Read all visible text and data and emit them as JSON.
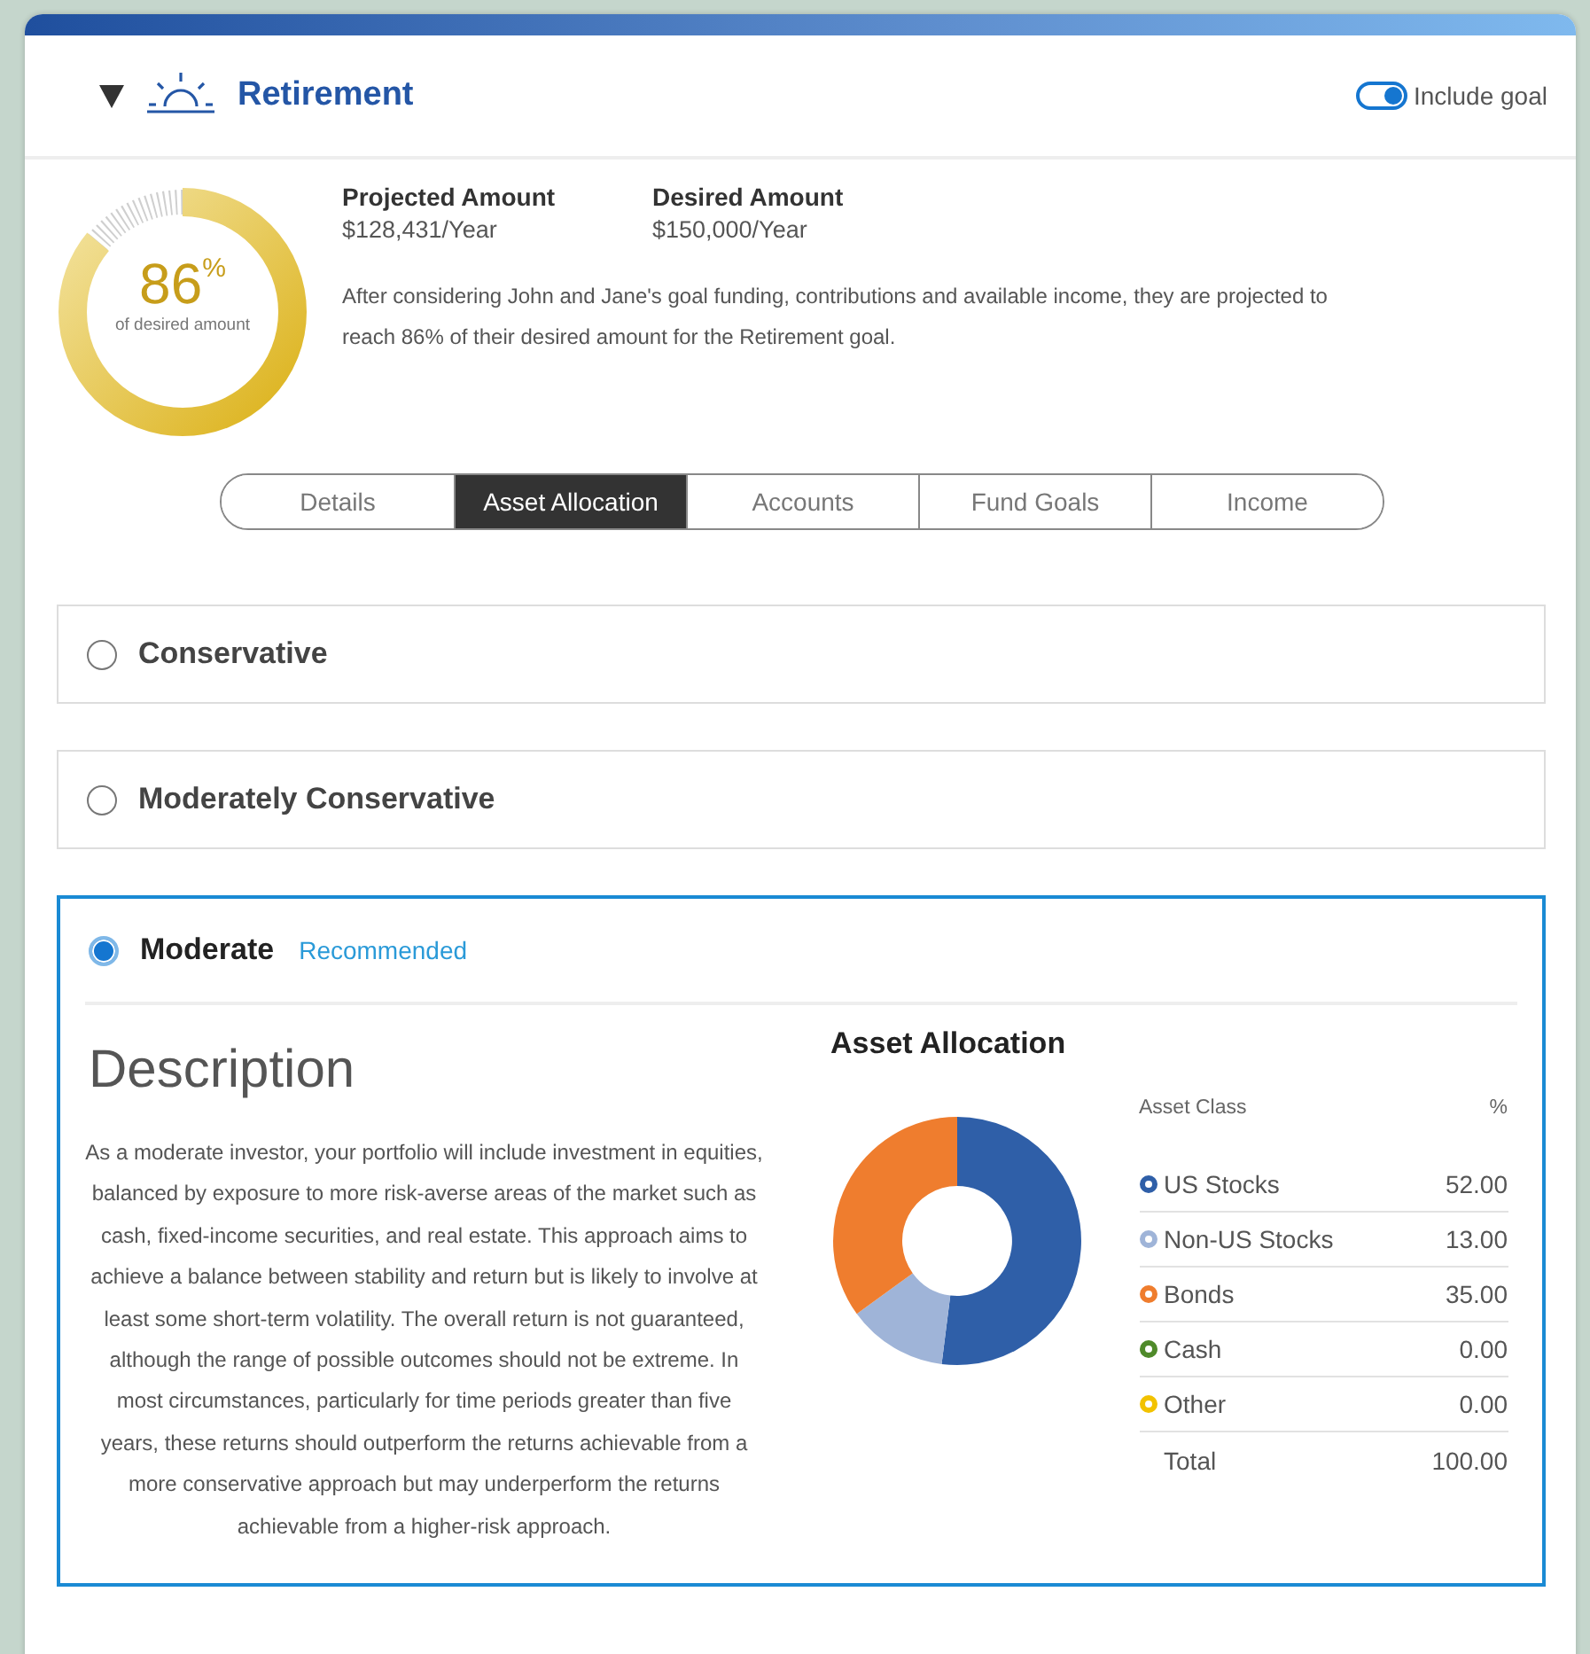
{
  "goal": {
    "title": "Retirement",
    "expanded": true,
    "include_toggle": {
      "label": "Include goal",
      "on": true
    }
  },
  "gauge": {
    "value": "86",
    "unit": "%",
    "caption": "of desired amount",
    "level": 0.86
  },
  "stats": [
    {
      "label": "Projected Amount",
      "value": "$128,431/Year"
    },
    {
      "label": "Desired Amount",
      "value": "$150,000/Year"
    }
  ],
  "summary": "After considering John and Jane's goal funding, contributions and available income, they are projected to reach 86% of their desired amount for the Retirement goal.",
  "tabs": [
    {
      "label": "Details",
      "selected": false
    },
    {
      "label": "Asset Allocation",
      "selected": true
    },
    {
      "label": "Accounts",
      "selected": false
    },
    {
      "label": "Fund Goals",
      "selected": false
    },
    {
      "label": "Income",
      "selected": false
    }
  ],
  "options": [
    {
      "label": "Conservative",
      "selected": false
    },
    {
      "label": "Moderately Conservative",
      "selected": false
    },
    {
      "label": "Moderate",
      "selected": true,
      "badge": "Recommended",
      "detail": {
        "heading": "Description",
        "text": "As a moderate investor, your portfolio will include investment in equities, balanced by exposure to more risk-averse areas of the market such as cash, fixed-income securities, and real estate. This approach aims to achieve a balance between stability and return but is likely to involve at least some short-term volatility. The overall return is not guaranteed, although the range of possible outcomes should not be extreme. In most circumstances, particularly for time periods greater than five years, these returns should outperform the returns achievable from a more conservative approach but may underperform the returns achievable from a higher-risk approach.",
        "allocation": {
          "title": "Asset Allocation",
          "columns": [
            "Asset Class",
            "%"
          ],
          "rows": [
            {
              "name": "US Stocks",
              "value": "52.00",
              "color": "#2f5fa8"
            },
            {
              "name": "Non-US Stocks",
              "value": "13.00",
              "color": "#9fb4d8"
            },
            {
              "name": "Bonds",
              "value": "35.00",
              "color": "#ef7d2e"
            },
            {
              "name": "Cash",
              "value": "0.00",
              "color": "#4f8a2a"
            },
            {
              "name": "Other",
              "value": "0.00",
              "color": "#f2c200"
            }
          ],
          "total": {
            "name": "Total",
            "value": "100.00"
          },
          "chart_data": {
            "type": "donut",
            "values": [
              52,
              13,
              35,
              0,
              0
            ]
          }
        }
      }
    }
  ]
}
